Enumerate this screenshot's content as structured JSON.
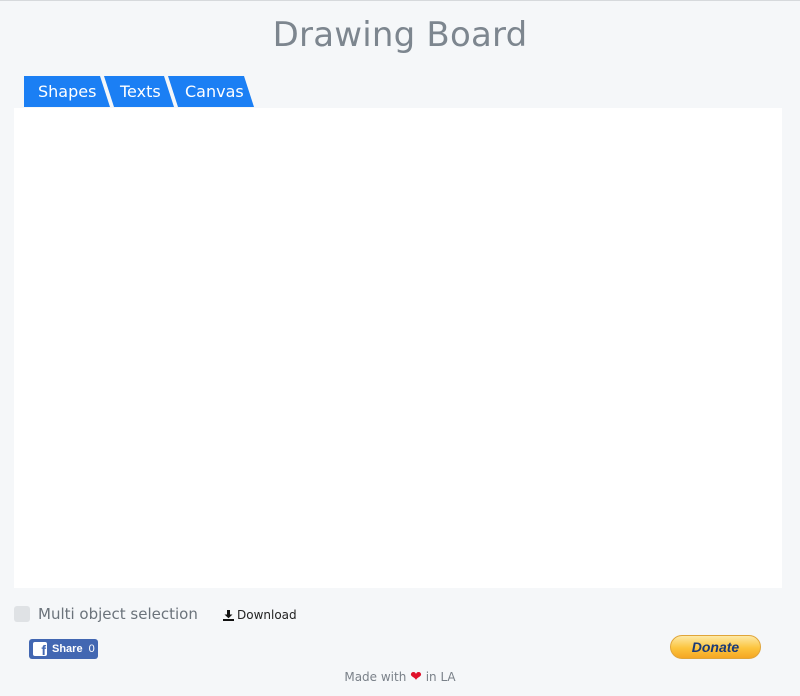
{
  "header": {
    "title": "Drawing Board"
  },
  "tabs": [
    {
      "label": "Shapes"
    },
    {
      "label": "Texts"
    },
    {
      "label": "Canvas"
    }
  ],
  "options": {
    "multi_select_label": "Multi object selection",
    "download_label": "Download"
  },
  "social": {
    "share_label": "Share",
    "share_count": "0"
  },
  "donate": {
    "label": "Donate"
  },
  "footer": {
    "prefix": "Made with",
    "suffix": "in LA"
  },
  "colors": {
    "accent": "#1b7ff4",
    "title": "#7d868f",
    "background": "#f5f7f9",
    "facebook": "#4267b2",
    "heart": "#e0112b"
  },
  "icons": {
    "download": "download-icon",
    "facebook": "facebook-icon",
    "heart": "heart-icon"
  }
}
